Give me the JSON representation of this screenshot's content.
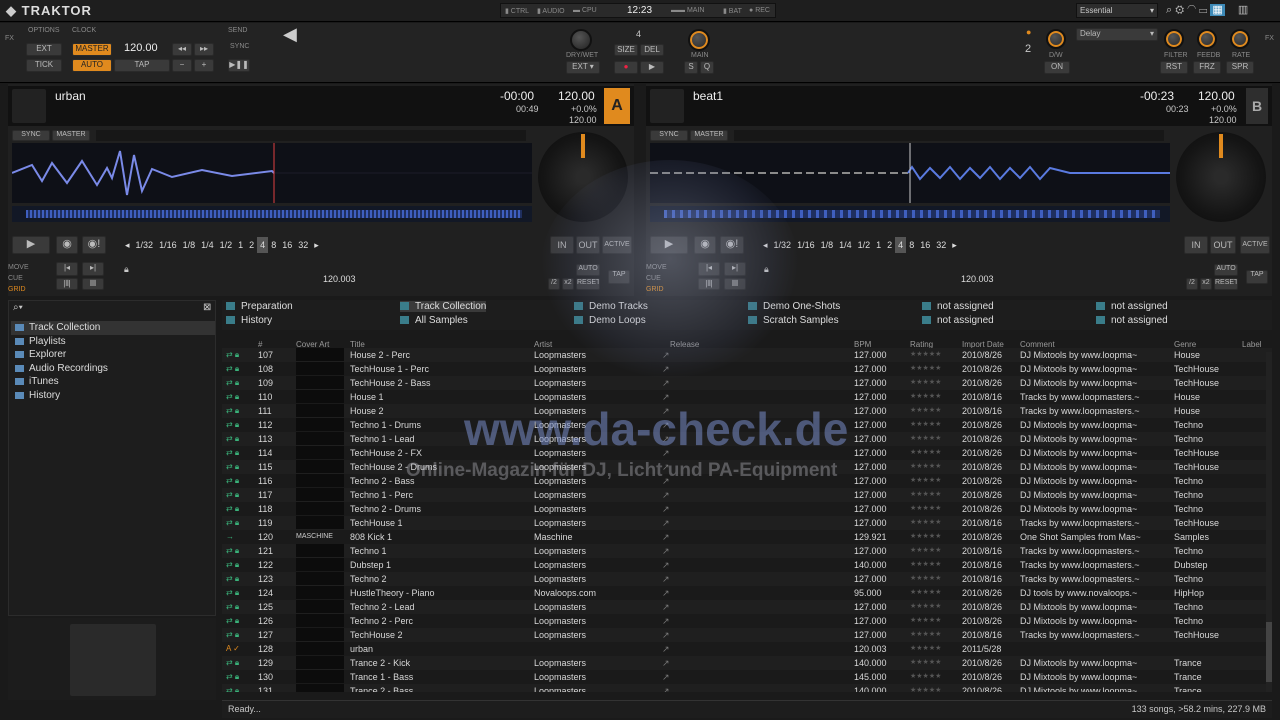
{
  "app": {
    "title": "TRAKTOR",
    "layout_select": "Essential"
  },
  "header": {
    "ctrl": "CTRL",
    "audio": "AUDIO",
    "cpu": "CPU",
    "time": "12:23",
    "main": "MAIN",
    "bat": "BAT",
    "rec": "REC"
  },
  "master": {
    "options": "OPTIONS",
    "clock": "CLOCK",
    "send": "SEND",
    "ext": "EXT",
    "tick": "TICK",
    "master_btn": "MASTER",
    "bpm": "120.00",
    "auto_btn": "AUTO",
    "tap_btn": "TAP",
    "sync": "SYNC",
    "minus": "−",
    "plus": "+"
  },
  "loop_recorder": {
    "dry_wet": "DRY/WET",
    "size_value": "4",
    "size": "SIZE",
    "del": "DEL",
    "ext": "EXT",
    "main": "MAIN",
    "s": "S",
    "q": "Q"
  },
  "fx": {
    "unit": "2",
    "dw": "D/W",
    "on": "ON",
    "effect": "Delay",
    "filter": "FILTER",
    "feedb": "FEEDB",
    "rate": "RATE",
    "rst": "RST",
    "frz": "FRZ",
    "spr": "SPR",
    "label": "FX"
  },
  "deck_a": {
    "title": "urban",
    "remaining": "-00:00",
    "elapsed": "00:49",
    "bpm": "120.00",
    "pitch": "+0.0%",
    "base_bpm": "120.00",
    "letter": "A",
    "sync": "SYNC",
    "master": "MASTER",
    "loop_sizes": [
      "1/32",
      "1/16",
      "1/8",
      "1/4",
      "1/2",
      "1",
      "2",
      "4",
      "8",
      "16",
      "32"
    ],
    "loop_selected": "4",
    "in": "IN",
    "out": "OUT",
    "active": "ACTIVE",
    "move": "MOVE",
    "cue": "CUE",
    "grid": "GRID",
    "grid_bpm": "120.003",
    "div2": "/2",
    "x2": "x2",
    "auto": "AUTO",
    "reset": "RESET",
    "tap": "TAP"
  },
  "deck_b": {
    "title": "beat1",
    "remaining": "-00:23",
    "elapsed": "00:23",
    "bpm": "120.00",
    "pitch": "+0.0%",
    "base_bpm": "120.00",
    "letter": "B",
    "sync": "SYNC",
    "master": "MASTER",
    "loop_sizes": [
      "1/32",
      "1/16",
      "1/8",
      "1/4",
      "1/2",
      "1",
      "2",
      "4",
      "8",
      "16",
      "32"
    ],
    "loop_selected": "4",
    "in": "IN",
    "out": "OUT",
    "active": "ACTIVE",
    "move": "MOVE",
    "cue": "CUE",
    "grid": "GRID",
    "grid_bpm": "120.003",
    "div2": "/2",
    "x2": "x2",
    "auto": "AUTO",
    "reset": "RESET",
    "tap": "TAP"
  },
  "browser": {
    "tree": [
      "Track Collection",
      "Playlists",
      "Explorer",
      "Audio Recordings",
      "iTunes",
      "History"
    ],
    "favorites": [
      [
        "Preparation",
        "History"
      ],
      [
        "Track Collection",
        "All Samples"
      ],
      [
        "Demo Tracks",
        "Demo Loops"
      ],
      [
        "Demo One-Shots",
        "Scratch Samples"
      ],
      [
        "not assigned",
        "not assigned"
      ],
      [
        "not assigned",
        "not assigned"
      ]
    ],
    "columns": [
      "#",
      "Cover Art",
      "Title",
      "Artist",
      "Release",
      "BPM",
      "Rating",
      "Import Date",
      "Comment",
      "Genre",
      "Label"
    ],
    "rows": [
      [
        "107",
        "House 2 - Perc",
        "Loopmasters",
        "127.000",
        "2010/8/26",
        "DJ Mixtools by www.loopma~",
        "House",
        false
      ],
      [
        "108",
        "TechHouse 1 - Perc",
        "Loopmasters",
        "127.000",
        "2010/8/26",
        "DJ Mixtools by www.loopma~",
        "TechHouse",
        false
      ],
      [
        "109",
        "TechHouse 2 - Bass",
        "Loopmasters",
        "127.000",
        "2010/8/26",
        "DJ Mixtools by www.loopma~",
        "TechHouse",
        false
      ],
      [
        "110",
        "House 1",
        "Loopmasters",
        "127.000",
        "2010/8/16",
        "Tracks by www.loopmasters.~",
        "House",
        false
      ],
      [
        "111",
        "House 2",
        "Loopmasters",
        "127.000",
        "2010/8/16",
        "Tracks by www.loopmasters.~",
        "House",
        false
      ],
      [
        "112",
        "Techno 1 - Drums",
        "Loopmasters",
        "127.000",
        "2010/8/26",
        "DJ Mixtools by www.loopma~",
        "Techno",
        false
      ],
      [
        "113",
        "Techno 1 - Lead",
        "Loopmasters",
        "127.000",
        "2010/8/26",
        "DJ Mixtools by www.loopma~",
        "Techno",
        false
      ],
      [
        "114",
        "TechHouse 2 - FX",
        "Loopmasters",
        "127.000",
        "2010/8/26",
        "DJ Mixtools by www.loopma~",
        "TechHouse",
        false
      ],
      [
        "115",
        "TechHouse 2 - Drums",
        "Loopmasters",
        "127.000",
        "2010/8/26",
        "DJ Mixtools by www.loopma~",
        "TechHouse",
        false
      ],
      [
        "116",
        "Techno 2 - Bass",
        "Loopmasters",
        "127.000",
        "2010/8/26",
        "DJ Mixtools by www.loopma~",
        "Techno",
        false
      ],
      [
        "117",
        "Techno 1 - Perc",
        "Loopmasters",
        "127.000",
        "2010/8/26",
        "DJ Mixtools by www.loopma~",
        "Techno",
        false
      ],
      [
        "118",
        "Techno 2 - Drums",
        "Loopmasters",
        "127.000",
        "2010/8/26",
        "DJ Mixtools by www.loopma~",
        "Techno",
        false
      ],
      [
        "119",
        "TechHouse 1",
        "Loopmasters",
        "127.000",
        "2010/8/16",
        "Tracks by www.loopmasters.~",
        "TechHouse",
        false
      ],
      [
        "120",
        "808 Kick 1",
        "Maschine",
        "129.921",
        "2010/8/26",
        "One Shot Samples from Mas~",
        "Samples",
        true
      ],
      [
        "121",
        "Techno 1",
        "Loopmasters",
        "127.000",
        "2010/8/16",
        "Tracks by www.loopmasters.~",
        "Techno",
        false
      ],
      [
        "122",
        "Dubstep 1",
        "Loopmasters",
        "140.000",
        "2010/8/16",
        "Tracks by www.loopmasters.~",
        "Dubstep",
        false
      ],
      [
        "123",
        "Techno 2",
        "Loopmasters",
        "127.000",
        "2010/8/16",
        "Tracks by www.loopmasters.~",
        "Techno",
        false
      ],
      [
        "124",
        "HustleTheory - Piano",
        "Novaloops.com",
        "95.000",
        "2010/8/26",
        "DJ tools by www.novaloops.~",
        "HipHop",
        false
      ],
      [
        "125",
        "Techno 2 - Lead",
        "Loopmasters",
        "127.000",
        "2010/8/26",
        "DJ Mixtools by www.loopma~",
        "Techno",
        false
      ],
      [
        "126",
        "Techno 2 - Perc",
        "Loopmasters",
        "127.000",
        "2010/8/26",
        "DJ Mixtools by www.loopma~",
        "Techno",
        false
      ],
      [
        "127",
        "TechHouse 2",
        "Loopmasters",
        "127.000",
        "2010/8/16",
        "Tracks by www.loopmasters.~",
        "TechHouse",
        false
      ],
      [
        "128",
        "urban",
        "",
        "120.003",
        "2011/5/28",
        "",
        "",
        false
      ],
      [
        "129",
        "Trance 2 - Kick",
        "Loopmasters",
        "140.000",
        "2010/8/26",
        "DJ Mixtools by www.loopma~",
        "Trance",
        false
      ],
      [
        "130",
        "Trance 1 - Bass",
        "Loopmasters",
        "145.000",
        "2010/8/26",
        "DJ Mixtools by www.loopma~",
        "Trance",
        false
      ],
      [
        "131",
        "Trance 2 - Bass",
        "Loopmasters",
        "140.000",
        "2010/8/26",
        "DJ Mixtools by www.loopma~",
        "Trance",
        false
      ]
    ],
    "maschine_logo": "MASCHINE",
    "status_left": "Ready...",
    "status_right": "133 songs, >58.2 mins, 227.9 MB"
  },
  "watermark": {
    "url": "www.da-check.de",
    "tagline": "Online-Magazin für DJ, Licht und PA-Equipment"
  }
}
